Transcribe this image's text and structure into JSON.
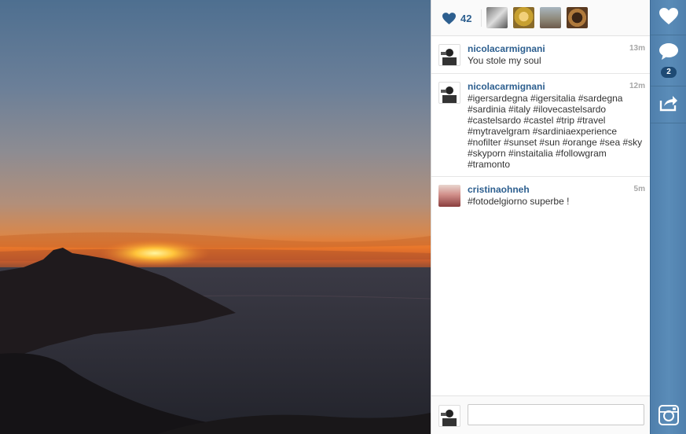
{
  "post": {
    "likes_count": "42"
  },
  "comments": [
    {
      "user": "nicolacarmignani",
      "time": "13m",
      "text": "You stole my soul"
    },
    {
      "user": "nicolacarmignani",
      "time": "12m",
      "text": "#igersardegna #igersitalia #sardegna #sardinia #italy #ilovecastelsardo #castelsardo #castel #trip #travel #mytravelgram #sardiniaexperience #nofilter #sunset #sun #orange #sea #sky #skyporn #instaitalia #followgram #tramonto"
    },
    {
      "user": "cristinaohneh",
      "time": "5m",
      "text": "#fotodelgiorno superbe !"
    }
  ],
  "comment_input": {
    "value": "",
    "placeholder": ""
  },
  "actions": {
    "comment_count": "2"
  },
  "icons": {
    "heart": "heart-icon",
    "comment": "speech-bubble-icon",
    "share": "share-arrow-icon",
    "camera": "instagram-camera-icon"
  },
  "colors": {
    "username": "#2d5f8f",
    "rail": "#5a8cb8"
  }
}
